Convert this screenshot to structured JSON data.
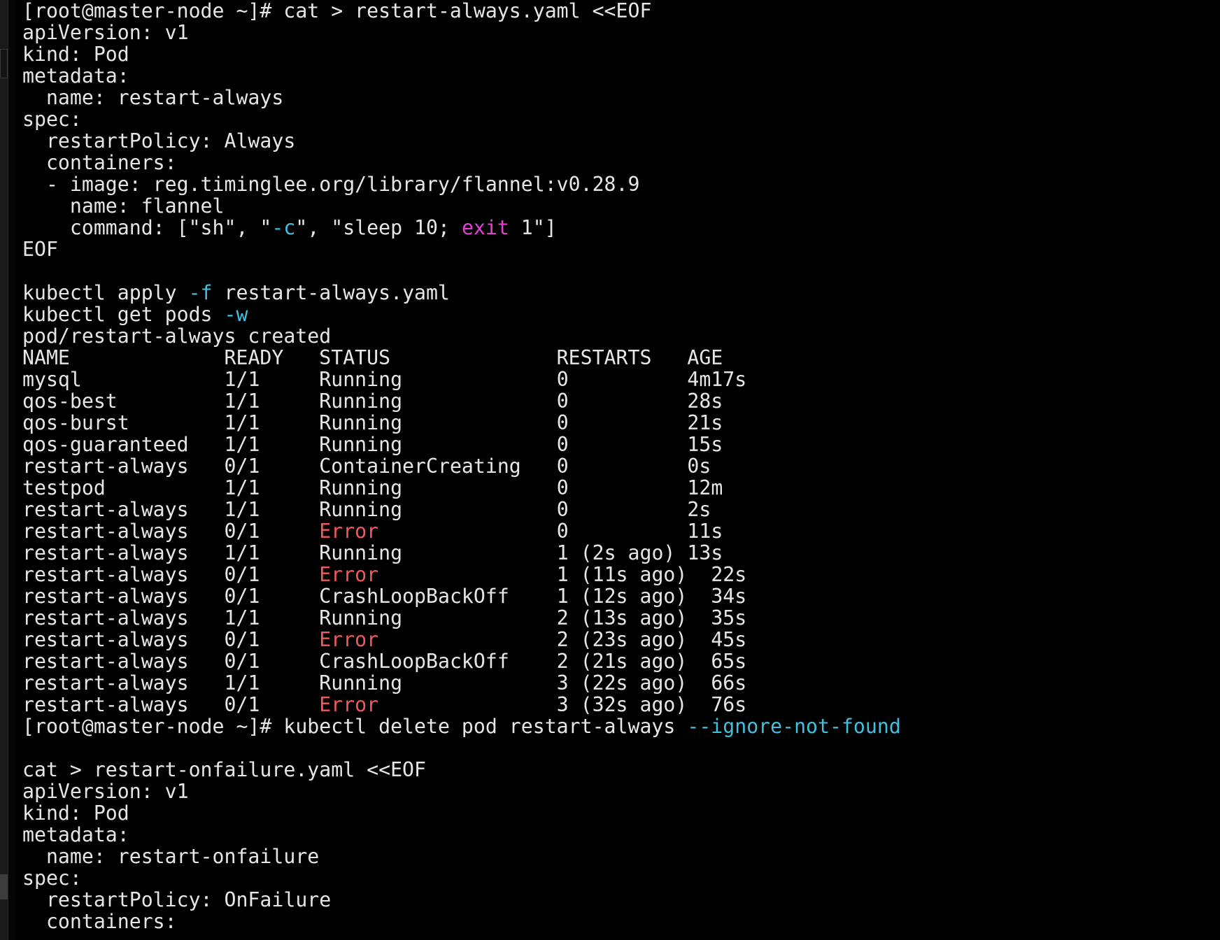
{
  "window": {
    "prompt": "[root@master-node ~]# "
  },
  "lines": [
    {
      "text": "[root@master-node ~]# cat > restart-always.yaml <<EOF"
    },
    {
      "text": "apiVersion: v1"
    },
    {
      "text": "kind: Pod"
    },
    {
      "text": "metadata:"
    },
    {
      "text": "  name: restart-always"
    },
    {
      "text": "spec:"
    },
    {
      "text": "  restartPolicy: Always"
    },
    {
      "text": "  containers:"
    },
    {
      "text": "  - image: reg.timinglee.org/library/flannel:v0.28.9"
    },
    {
      "text": "    name: flannel"
    },
    {
      "seg": [
        "    command: [\"sh\", \"",
        "-c",
        "\", \"sleep 10; ",
        "exit",
        " 1\"]"
      ]
    },
    {
      "text": "EOF"
    },
    {
      "text": ""
    },
    {
      "seg": [
        "kubectl apply ",
        "-f",
        " restart-always.yaml"
      ]
    },
    {
      "seg": [
        "kubectl get pods ",
        "-w"
      ]
    },
    {
      "text": "pod/restart-always created"
    }
  ],
  "pods_table": {
    "headers": [
      "NAME",
      "READY",
      "STATUS",
      "RESTARTS",
      "AGE"
    ],
    "rows": [
      {
        "name": "mysql",
        "ready": "1/1",
        "status": "Running",
        "restarts": "0",
        "age": "4m17s"
      },
      {
        "name": "qos-best",
        "ready": "1/1",
        "status": "Running",
        "restarts": "0",
        "age": "28s"
      },
      {
        "name": "qos-burst",
        "ready": "1/1",
        "status": "Running",
        "restarts": "0",
        "age": "21s"
      },
      {
        "name": "qos-guaranteed",
        "ready": "1/1",
        "status": "Running",
        "restarts": "0",
        "age": "15s"
      },
      {
        "name": "restart-always",
        "ready": "0/1",
        "status": "ContainerCreating",
        "restarts": "0",
        "age": "0s"
      },
      {
        "name": "testpod",
        "ready": "1/1",
        "status": "Running",
        "restarts": "0",
        "age": "12m"
      },
      {
        "name": "restart-always",
        "ready": "1/1",
        "status": "Running",
        "restarts": "0",
        "age": "2s"
      },
      {
        "name": "restart-always",
        "ready": "0/1",
        "status": "Error",
        "restarts": "0",
        "age": "11s"
      },
      {
        "name": "restart-always",
        "ready": "1/1",
        "status": "Running",
        "restarts": "1 (2s ago)",
        "age": "13s"
      },
      {
        "name": "restart-always",
        "ready": "0/1",
        "status": "Error",
        "restarts": "1 (11s ago)",
        "age": "22s"
      },
      {
        "name": "restart-always",
        "ready": "0/1",
        "status": "CrashLoopBackOff",
        "restarts": "1 (12s ago)",
        "age": "34s"
      },
      {
        "name": "restart-always",
        "ready": "1/1",
        "status": "Running",
        "restarts": "2 (13s ago)",
        "age": "35s"
      },
      {
        "name": "restart-always",
        "ready": "0/1",
        "status": "Error",
        "restarts": "2 (23s ago)",
        "age": "45s"
      },
      {
        "name": "restart-always",
        "ready": "0/1",
        "status": "CrashLoopBackOff",
        "restarts": "2 (21s ago)",
        "age": "65s"
      },
      {
        "name": "restart-always",
        "ready": "1/1",
        "status": "Running",
        "restarts": "3 (22s ago)",
        "age": "66s"
      },
      {
        "name": "restart-always",
        "ready": "0/1",
        "status": "Error",
        "restarts": "3 (32s ago)",
        "age": "76s"
      }
    ]
  },
  "tail_lines": [
    {
      "seg": [
        "[root@master-node ~]# kubectl delete pod restart-always ",
        "--ignore-not-found"
      ]
    },
    {
      "text": ""
    },
    {
      "text": "cat > restart-onfailure.yaml <<EOF"
    },
    {
      "text": "apiVersion: v1"
    },
    {
      "text": "kind: Pod"
    },
    {
      "text": "metadata:"
    },
    {
      "text": "  name: restart-onfailure"
    },
    {
      "text": "spec:"
    },
    {
      "text": "  restartPolicy: OnFailure"
    },
    {
      "text": "  containers:"
    }
  ],
  "colors": {
    "background": "#000000",
    "foreground": "#e6e6e6",
    "flag": "#3fc1e0",
    "keyword": "#e53fd4",
    "error": "#f05a5a"
  }
}
